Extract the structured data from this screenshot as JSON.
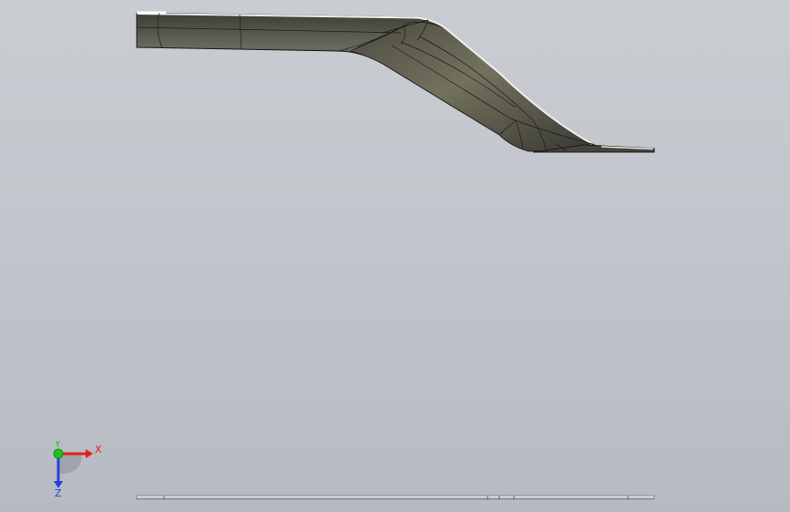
{
  "viewport": {
    "background_top": "#c9cdd2",
    "background_bottom": "#b6bbc1"
  },
  "model": {
    "name": "bent-bracket-part",
    "face_color": "#5b5a4f",
    "edge_color": "#1a1a1a",
    "highlight_color": "#e6e6e6"
  },
  "triad": {
    "x_label": "X",
    "y_label": "Y",
    "z_label": "Z",
    "x_color": "#e0201a",
    "y_color": "#19c61a",
    "z_color": "#2a3fe0"
  }
}
